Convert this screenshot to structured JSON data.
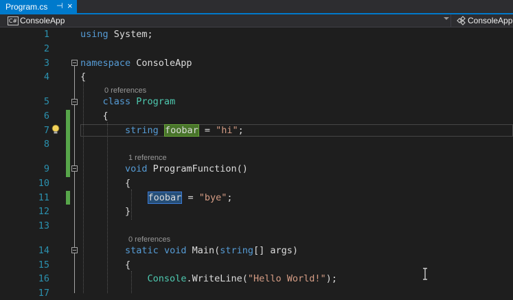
{
  "tab": {
    "title": "Program.cs",
    "pin_glyph": "⊣",
    "close_glyph": "×"
  },
  "navbar": {
    "project_icon": "C#",
    "project": "ConsoleApp",
    "class_selector": "ConsoleApp"
  },
  "code_lines": [
    {
      "number": "1",
      "text": "using System;"
    },
    {
      "number": "2",
      "text": ""
    },
    {
      "number": "3",
      "text": "namespace ConsoleApp"
    },
    {
      "number": "4",
      "text": "{"
    },
    {
      "number": "5",
      "text": "class Program"
    },
    {
      "number": "6",
      "text": "{"
    },
    {
      "number": "7",
      "text": "string foobar = \"hi\";"
    },
    {
      "number": "8",
      "text": ""
    },
    {
      "number": "9",
      "text": "void ProgramFunction()"
    },
    {
      "number": "10",
      "text": "{"
    },
    {
      "number": "11",
      "text": "foobar = \"bye\";"
    },
    {
      "number": "12",
      "text": "}"
    },
    {
      "number": "13",
      "text": ""
    },
    {
      "number": "14",
      "text": "static void Main(string[] args)"
    },
    {
      "number": "15",
      "text": "{"
    },
    {
      "number": "16",
      "text": "Console.WriteLine(\"Hello World!\");"
    },
    {
      "number": "17",
      "text": ""
    }
  ],
  "codelens": {
    "program": "0 references",
    "program_function": "1 reference",
    "main": "0 references"
  },
  "icons": {
    "lightbulb": "lightbulb-icon",
    "cursor": "text-cursor-icon"
  },
  "colors": {
    "accent": "#007acc",
    "keyword": "#569cd6",
    "type": "#4ec9b0",
    "string": "#d69d85",
    "line_number": "#2b91af",
    "change_marker": "#57a64a"
  }
}
